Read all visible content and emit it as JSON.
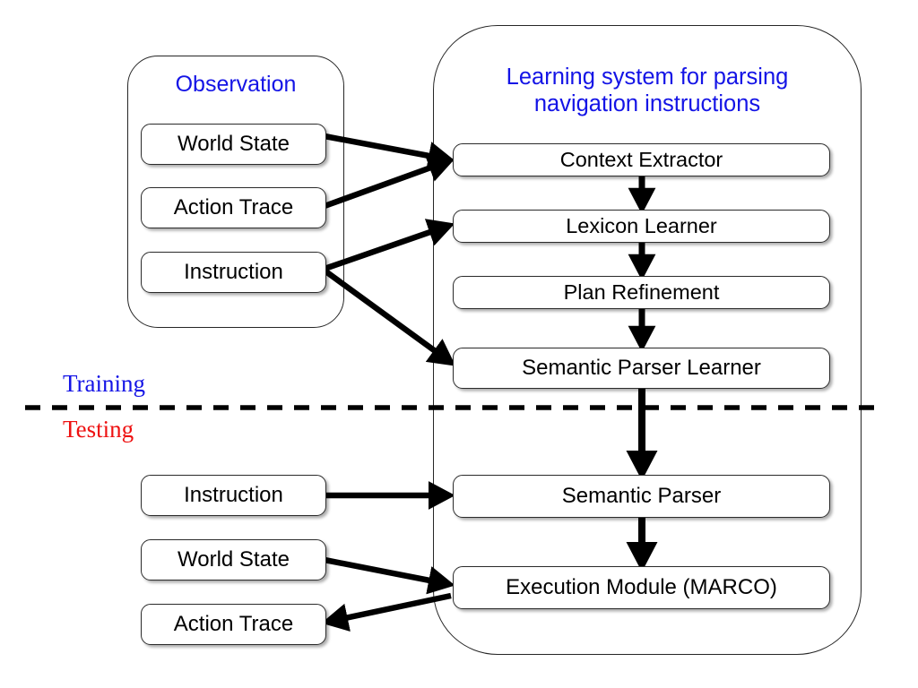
{
  "diagram": {
    "title": "Learning system for parsing navigation instructions",
    "colors": {
      "training_label": "#1414e6",
      "testing_label": "#ee1111",
      "group_title": "#1414e6",
      "node_border": "#2b2b2b",
      "arrow": "#000000",
      "background": "#ffffff"
    }
  },
  "observation_group": {
    "title": "Observation",
    "nodes": [
      {
        "id": "obs-world",
        "label": "World State"
      },
      {
        "id": "obs-action",
        "label": "Action Trace"
      },
      {
        "id": "obs-instruction",
        "label": "Instruction"
      }
    ]
  },
  "learning_group": {
    "title": "Learning system for parsing\nnavigation instructions",
    "nodes": [
      {
        "id": "context-extractor",
        "label": "Context Extractor"
      },
      {
        "id": "lexicon-learner",
        "label": "Lexicon Learner"
      },
      {
        "id": "plan-refinement",
        "label": "Plan Refinement"
      },
      {
        "id": "semantic-parser-learner",
        "label": "Semantic Parser Learner"
      },
      {
        "id": "semantic-parser",
        "label": "Semantic Parser"
      },
      {
        "id": "execution-module",
        "label": "Execution Module (MARCO)"
      }
    ]
  },
  "testing_group": {
    "nodes": [
      {
        "id": "test-instruction",
        "label": "Instruction"
      },
      {
        "id": "test-world",
        "label": "World State"
      },
      {
        "id": "test-action",
        "label": "Action Trace"
      }
    ]
  },
  "phases": {
    "above_divider": "Training",
    "below_divider": "Testing"
  },
  "edges": [
    {
      "from": "obs-world",
      "to": "context-extractor"
    },
    {
      "from": "obs-action",
      "to": "context-extractor"
    },
    {
      "from": "obs-instruction",
      "to": "lexicon-learner"
    },
    {
      "from": "obs-instruction",
      "to": "semantic-parser-learner"
    },
    {
      "from": "context-extractor",
      "to": "lexicon-learner"
    },
    {
      "from": "lexicon-learner",
      "to": "plan-refinement"
    },
    {
      "from": "plan-refinement",
      "to": "semantic-parser-learner"
    },
    {
      "from": "semantic-parser-learner",
      "to": "semantic-parser"
    },
    {
      "from": "test-instruction",
      "to": "semantic-parser"
    },
    {
      "from": "semantic-parser",
      "to": "execution-module"
    },
    {
      "from": "test-world",
      "to": "execution-module"
    },
    {
      "from": "execution-module",
      "to": "test-action"
    }
  ]
}
